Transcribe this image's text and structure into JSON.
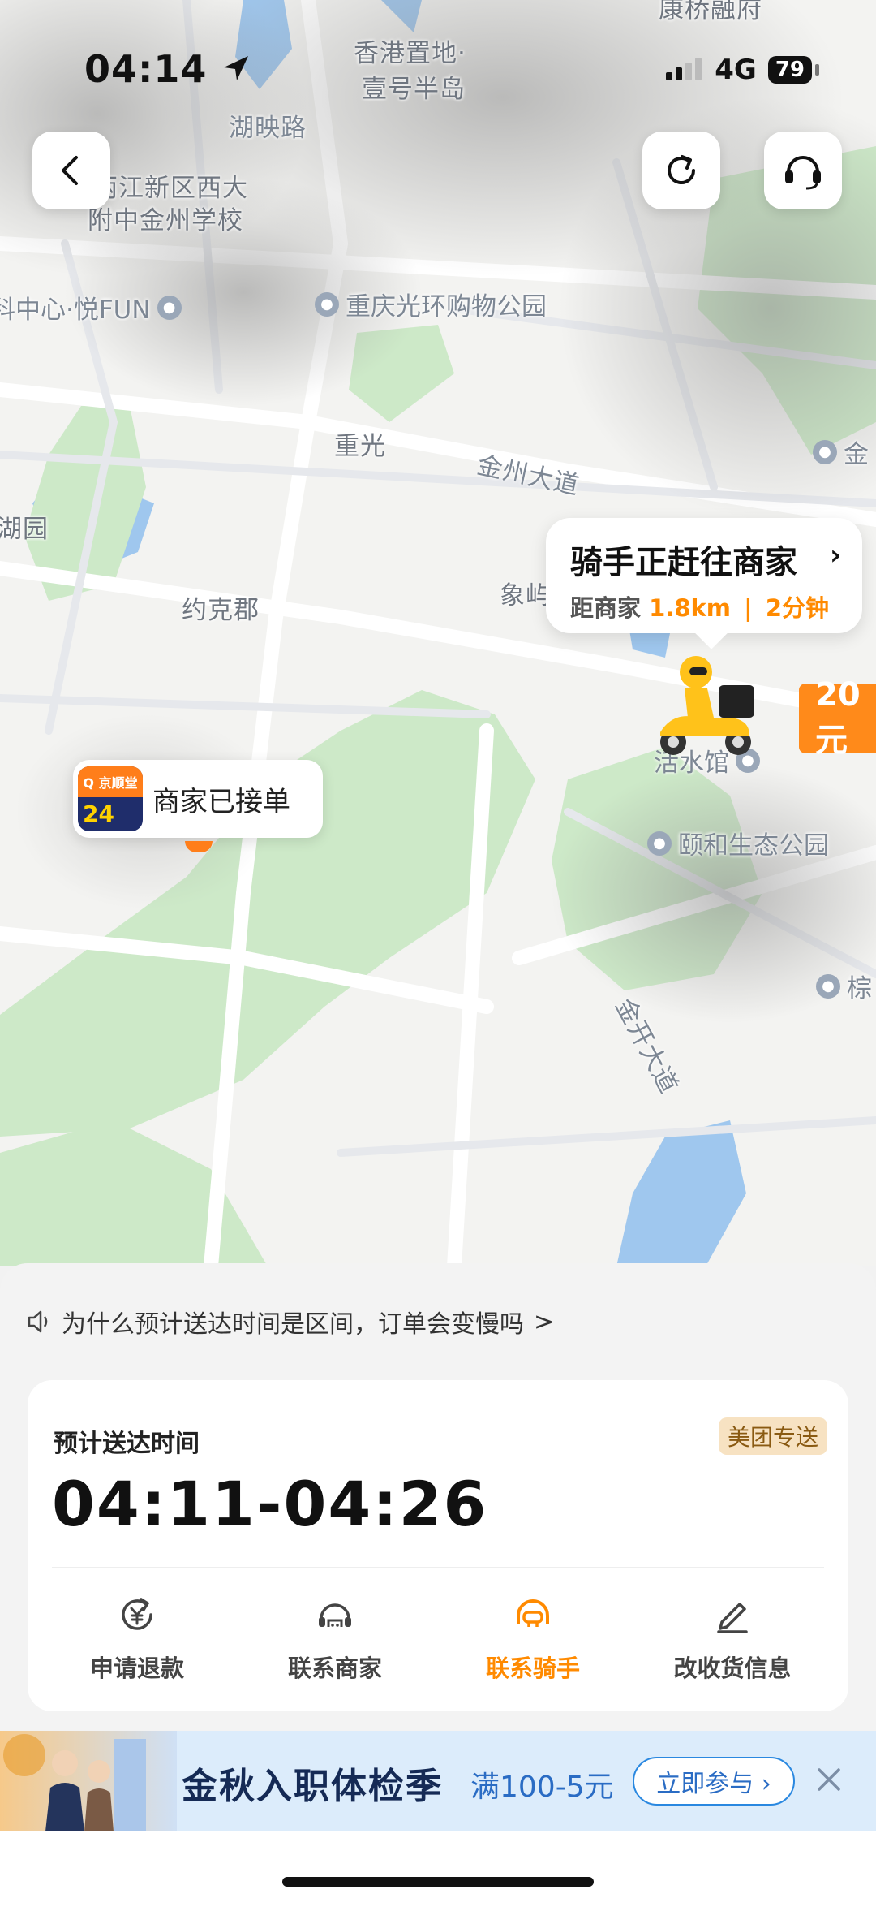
{
  "status_bar": {
    "time": "04:14",
    "network": "4G",
    "battery": "79"
  },
  "map": {
    "labels": {
      "hk_peninsula_1": "香港置地·",
      "hk_peninsula_2": "壹号半岛",
      "huying_road": "湖映路",
      "school_1": "两江新区西大",
      "school_2": "附中金州学校",
      "science_center": "科中心·悦FUN",
      "park_mall": "重庆光环购物公园",
      "chongguang": "重光",
      "jinzhou_road": "金州大道",
      "hu_yuan": "湖园",
      "yuekejun": "约克郡",
      "xiangyu": "象屿",
      "jin_right": "金",
      "huoshuiguan": "活水馆",
      "yihe_park": "颐和生态公园",
      "jinkai_road": "金开大道",
      "zong": "棕",
      "top_cut": "康桥融府"
    },
    "price_tag": "20元"
  },
  "rider_bubble": {
    "title": "骑手正赶往商家",
    "distance_label": "距商家",
    "distance_value": "1.8km",
    "separator": "|",
    "eta": "2分钟"
  },
  "merchant_tag": {
    "logo_top": "Q 京顺堂",
    "logo_num": "24",
    "label": "商家已接单"
  },
  "notice": {
    "text": "为什么预计送达时间是区间，订单会变慢吗",
    "arrow": ">"
  },
  "delivery": {
    "eta_label": "预计送达时间",
    "eta_value": "04:11-04:26",
    "badge": "美团专送"
  },
  "actions": [
    {
      "label": "申请退款",
      "icon": "refund-icon"
    },
    {
      "label": "联系商家",
      "icon": "merchant-contact-icon"
    },
    {
      "label": "联系骑手",
      "icon": "rider-contact-icon"
    },
    {
      "label": "改收货信息",
      "icon": "edit-icon"
    }
  ],
  "promo": {
    "title": "金秋入职体检季",
    "offer": "满100-5元",
    "button": "立即参与 ›"
  },
  "colors": {
    "accent": "#ff8a00",
    "badge_bg": "#f7e2c2",
    "promo_bg": "#dcecfb"
  }
}
